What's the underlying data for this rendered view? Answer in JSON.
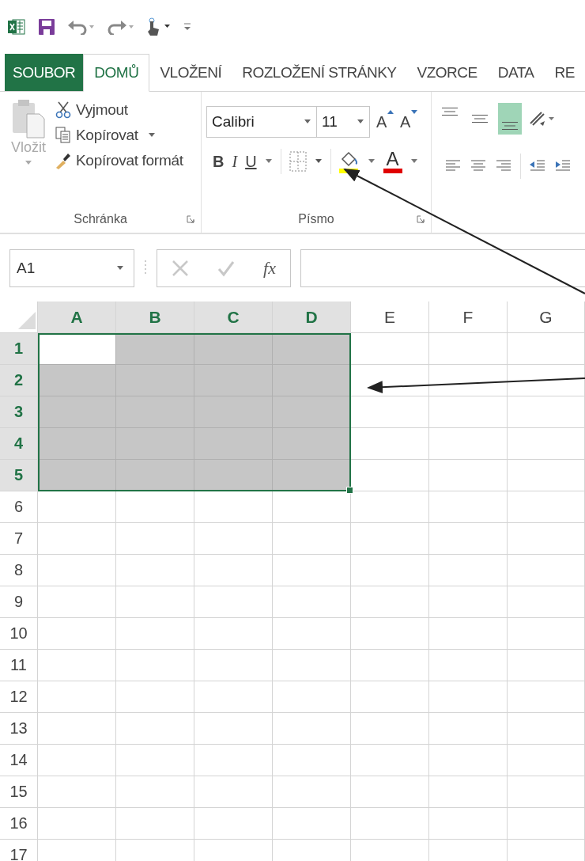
{
  "tabs": [
    {
      "label": "SOUBOR",
      "kind": "file",
      "selected": false
    },
    {
      "label": "DOMŮ",
      "kind": "tab",
      "selected": true
    },
    {
      "label": "VLOŽENÍ",
      "kind": "tab",
      "selected": false
    },
    {
      "label": "ROZLOŽENÍ STRÁNKY",
      "kind": "tab",
      "selected": false
    },
    {
      "label": "VZORCE",
      "kind": "tab",
      "selected": false
    },
    {
      "label": "DATA",
      "kind": "tab",
      "selected": false
    },
    {
      "label": "RE",
      "kind": "tab",
      "selected": false
    }
  ],
  "ribbon": {
    "clipboard": {
      "label": "Schránka",
      "paste": {
        "label": "Vložit",
        "disabled": true
      },
      "actions": [
        {
          "label": "Vyjmout",
          "kind": "cut",
          "dropdown": false
        },
        {
          "label": "Kopírovat",
          "kind": "copy",
          "dropdown": true
        },
        {
          "label": "Kopírovat formát",
          "kind": "format",
          "dropdown": false
        }
      ]
    },
    "font": {
      "label": "Písmo",
      "font_name": "Calibri",
      "font_size": "11",
      "grow": "A",
      "shrink": "A",
      "bold": "B",
      "italic": "I",
      "underline": "U",
      "font_color": "A"
    },
    "alignment": {
      "top_buttons": [
        {
          "kind": "top",
          "selected": false
        },
        {
          "kind": "middle",
          "selected": false
        },
        {
          "kind": "bottom",
          "selected": true
        }
      ]
    }
  },
  "formula_bar": {
    "name_box": "A1",
    "function_label": "fx"
  },
  "sheet": {
    "columns": [
      {
        "label": "A",
        "selected": true
      },
      {
        "label": "B",
        "selected": true
      },
      {
        "label": "C",
        "selected": true
      },
      {
        "label": "D",
        "selected": true
      },
      {
        "label": "E",
        "selected": false
      },
      {
        "label": "F",
        "selected": false
      },
      {
        "label": "G",
        "selected": false
      }
    ],
    "rows": [
      {
        "label": "1",
        "selected": true,
        "cells": [
          {
            "selected": true,
            "active": true
          },
          {
            "selected": true,
            "active": false
          },
          {
            "selected": true,
            "active": false
          },
          {
            "selected": true,
            "active": false
          }
        ]
      },
      {
        "label": "2",
        "selected": true,
        "cells": [
          {
            "selected": true,
            "active": false
          },
          {
            "selected": true,
            "active": false
          },
          {
            "selected": true,
            "active": false
          },
          {
            "selected": true,
            "active": false
          }
        ]
      },
      {
        "label": "3",
        "selected": true,
        "cells": [
          {
            "selected": true,
            "active": false
          },
          {
            "selected": true,
            "active": false
          },
          {
            "selected": true,
            "active": false
          },
          {
            "selected": true,
            "active": false
          }
        ]
      },
      {
        "label": "4",
        "selected": true,
        "cells": [
          {
            "selected": true,
            "active": false
          },
          {
            "selected": true,
            "active": false
          },
          {
            "selected": true,
            "active": false
          },
          {
            "selected": true,
            "active": false
          }
        ]
      },
      {
        "label": "5",
        "selected": true,
        "cells": [
          {
            "selected": true,
            "active": false
          },
          {
            "selected": true,
            "active": false
          },
          {
            "selected": true,
            "active": false
          },
          {
            "selected": true,
            "active": false
          }
        ]
      },
      {
        "label": "6",
        "selected": false
      },
      {
        "label": "7",
        "selected": false
      },
      {
        "label": "8",
        "selected": false
      },
      {
        "label": "9",
        "selected": false
      },
      {
        "label": "10",
        "selected": false
      },
      {
        "label": "11",
        "selected": false
      },
      {
        "label": "12",
        "selected": false
      },
      {
        "label": "13",
        "selected": false
      },
      {
        "label": "14",
        "selected": false
      },
      {
        "label": "15",
        "selected": false
      },
      {
        "label": "16",
        "selected": false
      },
      {
        "label": "17",
        "selected": false
      }
    ]
  }
}
